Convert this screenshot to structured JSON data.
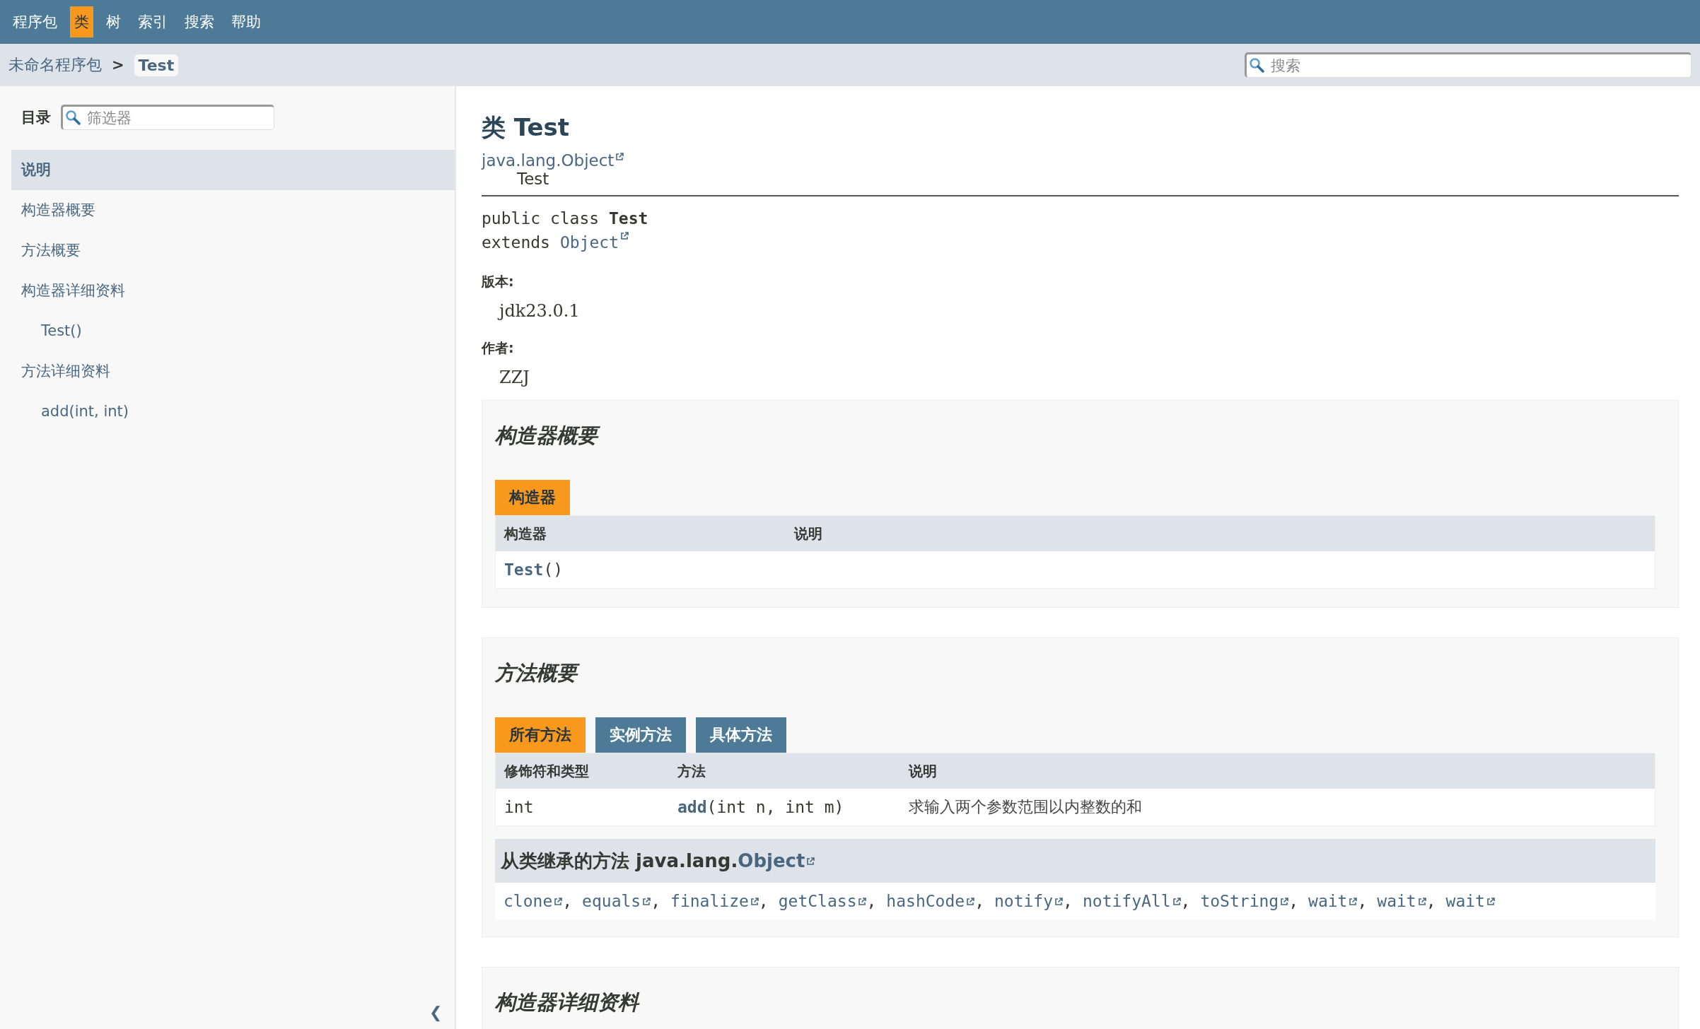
{
  "nav": [
    {
      "label": "程序包",
      "selected": false
    },
    {
      "label": "类",
      "selected": true
    },
    {
      "label": "树",
      "selected": false
    },
    {
      "label": "索引",
      "selected": false
    },
    {
      "label": "搜索",
      "selected": false
    },
    {
      "label": "帮助",
      "selected": false
    }
  ],
  "breadcrumb": {
    "items": [
      {
        "label": "未命名程序包",
        "current": false
      },
      {
        "label": "Test",
        "current": true
      }
    ],
    "separator": ">"
  },
  "search": {
    "placeholder": "搜索"
  },
  "sidebar": {
    "title": "目录",
    "filter_placeholder": "筛选器",
    "collapse_glyph": "❮",
    "items": [
      {
        "label": "说明",
        "selected": true
      },
      {
        "label": "构造器概要",
        "selected": false
      },
      {
        "label": "方法概要",
        "selected": false
      },
      {
        "label": "构造器详细资料",
        "selected": false,
        "children": [
          {
            "label": "Test()",
            "selected": false
          }
        ]
      },
      {
        "label": "方法详细资料",
        "selected": false,
        "children": [
          {
            "label": "add(int, int)",
            "selected": false
          }
        ]
      }
    ]
  },
  "class": {
    "title": "类 Test",
    "hierarchy_root": "java.lang.Object",
    "hierarchy_leaf": "Test",
    "declaration": "public class **Test**",
    "extends_keyword": "extends",
    "superclass": "Object",
    "tags": [
      {
        "label": "版本:",
        "value": "jdk23.0.1"
      },
      {
        "label": "作者:",
        "value": "ZZJ"
      }
    ]
  },
  "constructor_summary": {
    "title": "构造器概要",
    "tabs": [
      {
        "label": "构造器",
        "selected": true
      }
    ],
    "columns": [
      "构造器",
      "说明"
    ],
    "rows": [
      {
        "name": "Test",
        "params": "()"
      }
    ]
  },
  "method_summary": {
    "title": "方法概要",
    "tabs": [
      {
        "label": "所有方法",
        "selected": true
      },
      {
        "label": "实例方法",
        "selected": false
      },
      {
        "label": "具体方法",
        "selected": false
      }
    ],
    "columns": [
      "修饰符和类型",
      "方法",
      "说明"
    ],
    "rows": [
      {
        "type": "int",
        "name": "add",
        "params": "(int n, int m)",
        "description": "求输入两个参数范围以内整数的和"
      }
    ],
    "inherited": {
      "prefix": "从类继承的方法 java.lang.",
      "class_link": "Object",
      "separator": ",",
      "methods": [
        "clone",
        "equals",
        "finalize",
        "getClass",
        "hashCode",
        "notify",
        "notifyAll",
        "toString",
        "wait",
        "wait",
        "wait"
      ]
    }
  },
  "constructor_detail": {
    "title": "构造器详细资料"
  }
}
